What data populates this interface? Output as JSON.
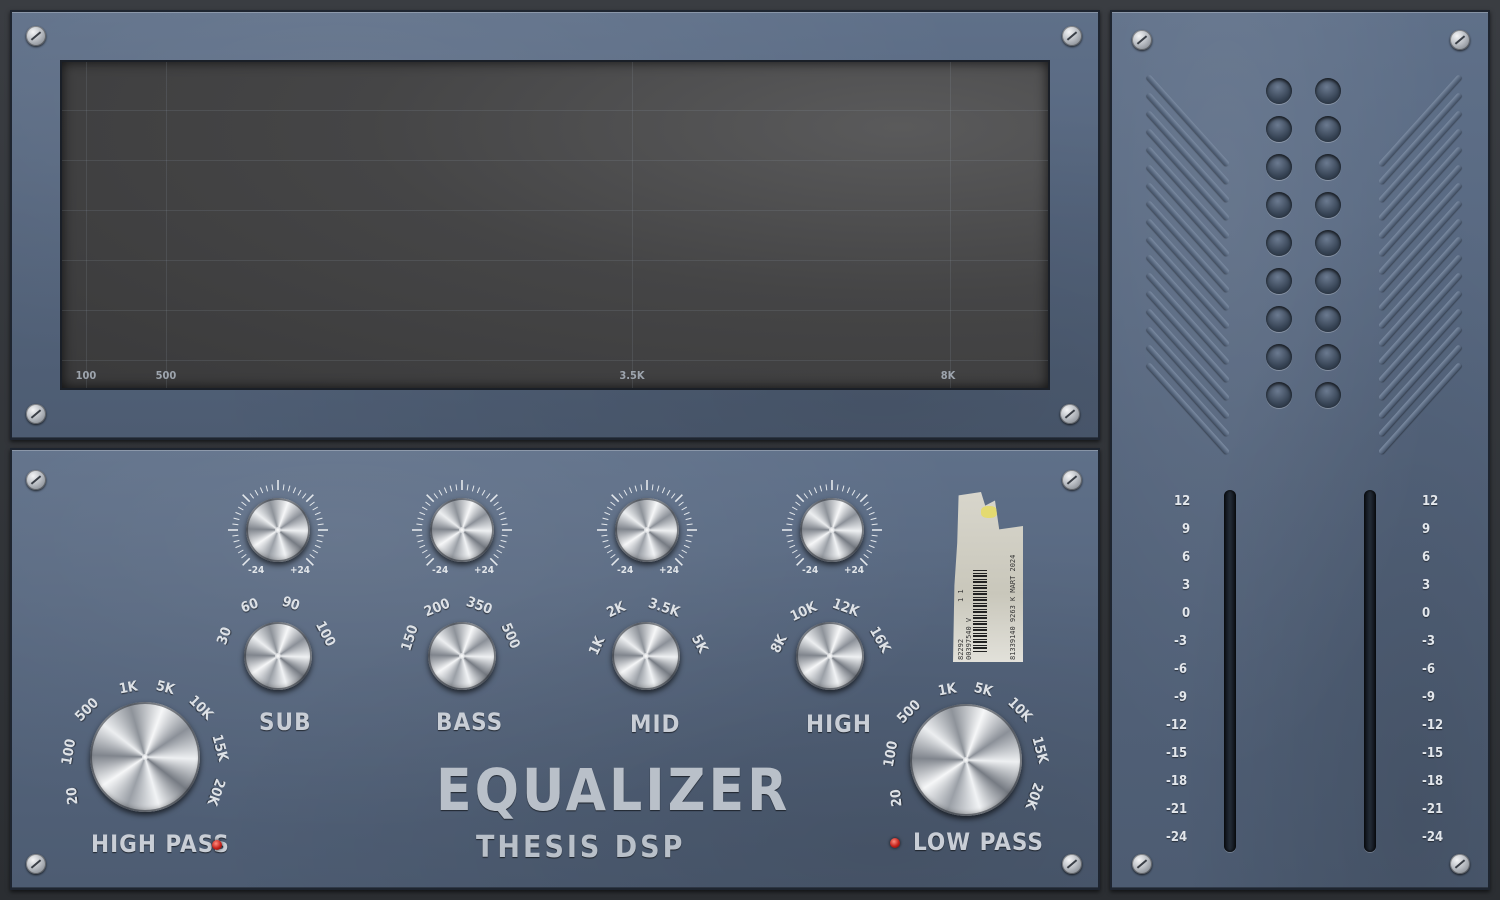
{
  "display": {
    "freq_labels": [
      "100",
      "500",
      "3.5K",
      "8K"
    ]
  },
  "bands": [
    {
      "name": "SUB",
      "gain_min": "-24",
      "gain_max": "+24",
      "freqs": [
        "30",
        "60",
        "90",
        "100"
      ]
    },
    {
      "name": "BASS",
      "gain_min": "-24",
      "gain_max": "+24",
      "freqs": [
        "150",
        "200",
        "350",
        "500"
      ]
    },
    {
      "name": "MID",
      "gain_min": "-24",
      "gain_max": "+24",
      "freqs": [
        "1K",
        "2K",
        "3.5K",
        "5K"
      ]
    },
    {
      "name": "HIGH",
      "gain_min": "-24",
      "gain_max": "+24",
      "freqs": [
        "8K",
        "10K",
        "12K",
        "16K"
      ]
    }
  ],
  "high_pass": {
    "label": "HIGH PASS",
    "freqs": [
      "20",
      "100",
      "500",
      "1K",
      "5K",
      "10K",
      "15K",
      "20K"
    ]
  },
  "low_pass": {
    "label": "LOW PASS",
    "freqs": [
      "20",
      "100",
      "500",
      "1K",
      "5K",
      "10K",
      "15K",
      "20K"
    ]
  },
  "brand": {
    "title": "EQUALIZER",
    "subtitle": "THESIS DSP"
  },
  "sticker": {
    "lines": [
      "82292",
      "1 1",
      "00397540 V",
      "81339140 9263 K MART 2024"
    ]
  },
  "meter_scale": [
    "12",
    "9",
    "6",
    "3",
    "0",
    "-3",
    "-6",
    "-9",
    "-12",
    "-15",
    "-18",
    "-21",
    "-24"
  ],
  "colors": {
    "panel": "#56667e",
    "led": "#c3201a",
    "screen": "#444445"
  }
}
